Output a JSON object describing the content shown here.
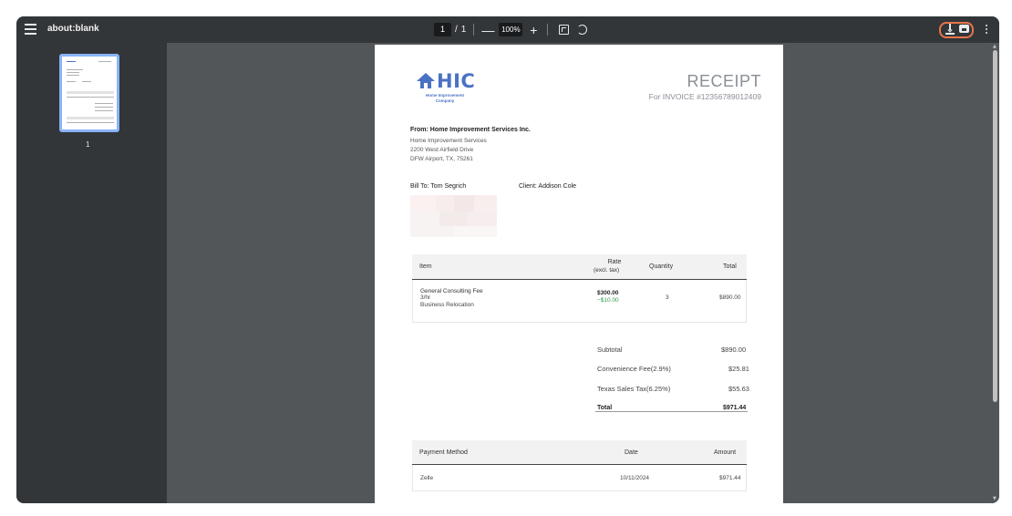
{
  "toolbar": {
    "doc_title": "about:blank",
    "current_page": "1",
    "page_sep": "/",
    "total_pages": "1",
    "zoom_minus": "—",
    "zoom": "100%",
    "zoom_plus": "+"
  },
  "sidebar": {
    "thumbnail_label": "1"
  },
  "receipt": {
    "logo_text": "HIC",
    "logo_sub": "Home Improvement Company",
    "title": "RECEIPT",
    "invoice_ref": "For INVOICE #12356789012409",
    "from_heading": "From: Home Improvement Services Inc.",
    "from_lines": [
      "Home Improvement Services",
      "2200 West Airfield Drive",
      "DFW Airport, TX, 75261"
    ],
    "bill_to": "Bill To: Tom Segrich",
    "client": "Client: Addison Cole",
    "items_table": {
      "headers": {
        "item": "Item",
        "rate": "Rate",
        "rate_sub": "(excl. tax)",
        "quantity": "Quantity",
        "total": "Total"
      },
      "rows": [
        {
          "name": "General Consulting Fee",
          "unit": "3/hr",
          "category": "Business Relocation",
          "rate": "$300.00",
          "discount": "−$10.00",
          "quantity": "3",
          "total": "$890.00"
        }
      ]
    },
    "totals": {
      "subtotal_label": "Subtotal",
      "subtotal": "$890.00",
      "fee_label": "Convenience Fee(2.9%)",
      "fee": "$25.81",
      "tax_label": "Texas Sales Tax(6.25%)",
      "tax": "$55.63",
      "total_label": "Total",
      "total": "$971.44"
    },
    "payments_table": {
      "headers": {
        "method": "Payment Method",
        "date": "Date",
        "amount": "Amount"
      },
      "rows": [
        {
          "method": "Zelle",
          "date": "10/11/2024",
          "amount": "$971.44"
        }
      ]
    }
  },
  "colors": {
    "toolbar_bg": "#323639",
    "viewer_bg": "#525659",
    "brand_blue": "#4a72c4",
    "highlight_orange": "#e8744a",
    "discount_green": "#2e9b4f"
  }
}
